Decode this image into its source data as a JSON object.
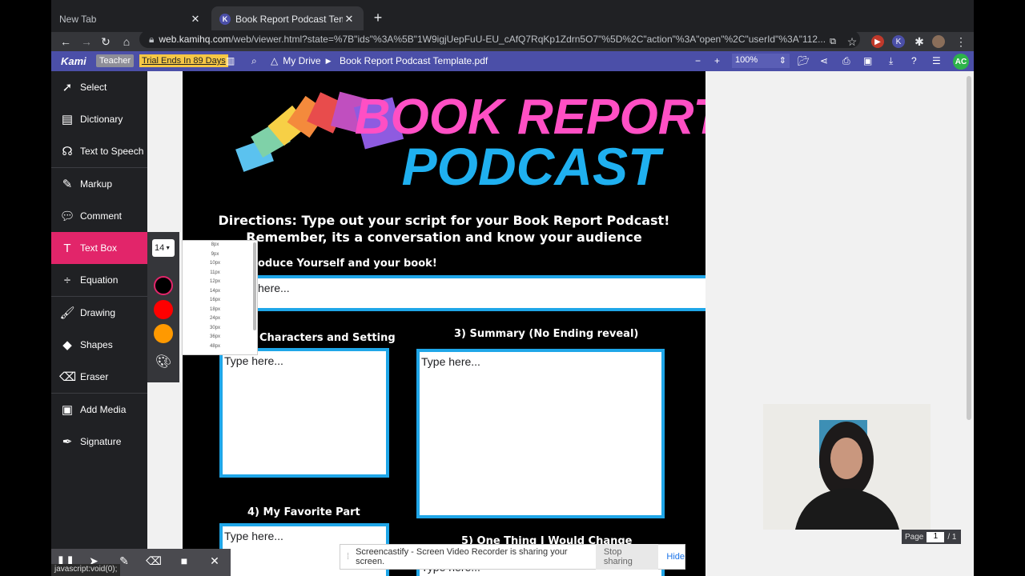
{
  "browser": {
    "tabs": [
      {
        "title": "New Tab",
        "close": "✕"
      },
      {
        "title": "Book Report Podcast Template",
        "favicon": "K",
        "close": "✕"
      }
    ],
    "new_tab": "+",
    "url_host": "web.kamihq.com",
    "url_path": "/web/viewer.html?state=%7B\"ids\"%3A%5B\"1W9igjUepFuU-EU_cAfQ7RqKp1Zdrn5O7\"%5D%2C\"action\"%3A\"open\"%2C\"userId\"%3A\"112..."
  },
  "kami": {
    "logo": "Kami",
    "role_badge": "Teacher",
    "trial_badge": "Trial Ends In 89 Days",
    "drive_label": "My Drive",
    "document_name": "Book Report Podcast Template.pdf",
    "zoom": "100%",
    "user_initials": "AC",
    "brand_color": "#4b4fa8"
  },
  "sidebar": {
    "items": [
      {
        "label": "Select",
        "icon": "cursor-icon"
      },
      {
        "label": "Dictionary",
        "icon": "book-icon"
      },
      {
        "label": "Text to Speech",
        "icon": "speech-icon"
      },
      {
        "label": "Markup",
        "icon": "highlighter-icon"
      },
      {
        "label": "Comment",
        "icon": "comment-icon"
      },
      {
        "label": "Text Box",
        "icon": "text-icon",
        "active": true
      },
      {
        "label": "Equation",
        "icon": "divide-icon"
      },
      {
        "label": "Drawing",
        "icon": "brush-icon"
      },
      {
        "label": "Shapes",
        "icon": "shapes-icon"
      },
      {
        "label": "Eraser",
        "icon": "eraser-icon"
      },
      {
        "label": "Add Media",
        "icon": "media-icon"
      },
      {
        "label": "Signature",
        "icon": "pen-nib-icon"
      }
    ],
    "active_color": "#e2256a"
  },
  "text_tool": {
    "font_size": "14",
    "size_options": [
      "8px",
      "9px",
      "10px",
      "11px",
      "12px",
      "14px",
      "16px",
      "18px",
      "24px",
      "30px",
      "36px",
      "48px"
    ],
    "colors": [
      "#000000",
      "#ff0000",
      "#ff9900"
    ]
  },
  "pdf": {
    "title_line1": "BOOK REPORT",
    "title_line2": "PODCAST",
    "directions_line1": "Directions: Type out your script for your Book Report Podcast!",
    "directions_line2": "Remember, its a conversation and know your audience",
    "section1": "oduce Yourself and your book!",
    "section2": "Characters and Setting",
    "section3": "3) Summary (No Ending reveal)",
    "section4": "4) My Favorite Part",
    "section5": "5) One Thing I Would Change",
    "field1_text": "here...",
    "field_placeholder": "Type here..."
  },
  "page_indicator": {
    "label": "Page",
    "current": "1",
    "total": "/ 1"
  },
  "screencastify": {
    "message": "Screencastify - Screen Video Recorder is sharing your screen.",
    "stop": "Stop sharing",
    "hide": "Hide"
  },
  "status_link": "javascript:void(0);"
}
